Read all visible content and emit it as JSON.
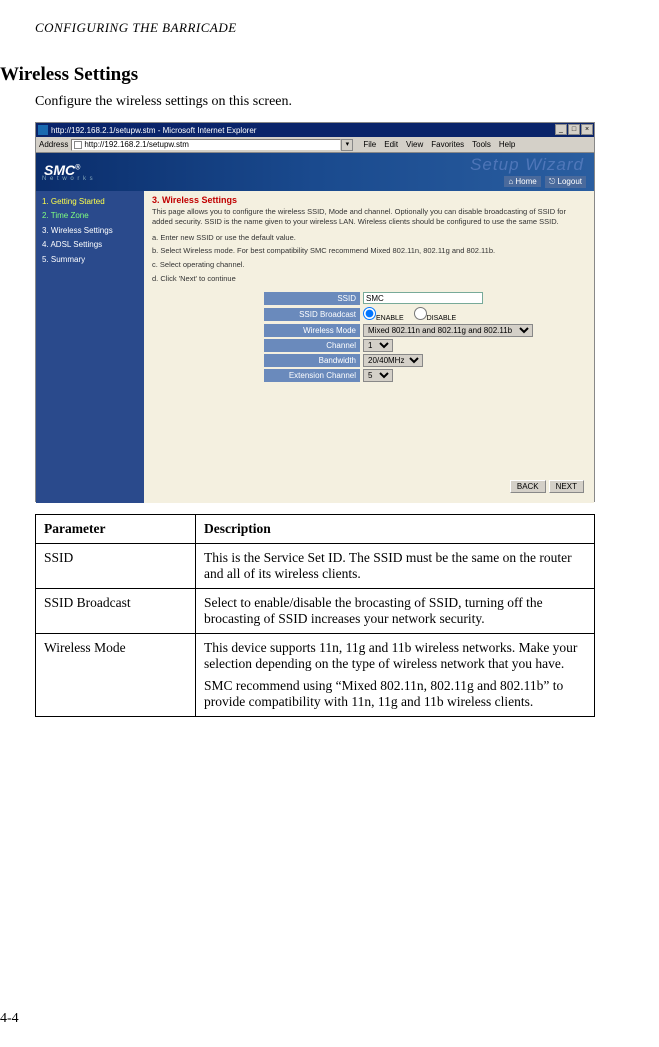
{
  "header": "CONFIGURING THE BARRICADE",
  "section_title": "Wireless Settings",
  "section_intro": "Configure the wireless settings on this screen.",
  "page_number": "4-4",
  "screenshot": {
    "titlebar": "http://192.168.2.1/setupw.stm - Microsoft Internet Explorer",
    "win_min": "_",
    "win_max": "□",
    "win_close": "×",
    "addr_label": "Address",
    "addr_url": "http://192.168.2.1/setupw.stm",
    "addr_go": "▾",
    "menu": [
      "File",
      "Edit",
      "View",
      "Favorites",
      "Tools",
      "Help"
    ],
    "logo": "SMC",
    "logo_reg": "®",
    "logo_sub": "N e t w o r k s",
    "setup_wizard": "Setup Wizard",
    "home_link": "⌂ Home",
    "logout_link": "⎋ Logout",
    "sidebar": [
      {
        "label": "1. Getting Started",
        "cls": "yellow"
      },
      {
        "label": "2. Time Zone",
        "cls": "green"
      },
      {
        "label": "3. Wireless Settings",
        "cls": ""
      },
      {
        "label": "4. ADSL Settings",
        "cls": ""
      },
      {
        "label": "5. Summary",
        "cls": ""
      }
    ],
    "pane_title": "3. Wireless Settings",
    "pane_desc": "This page allows you to configure the wireless SSID, Mode and channel. Optionally you can disable broadcasting of SSID for added security. SSID is the name given to your wireless LAN. Wireless clients should be configured to use the same SSID.",
    "step_a": "a. Enter new SSID or use the default value.",
    "step_b": "b. Select Wireless mode. For best compatibility SMC recommend Mixed 802.11n, 802.11g and 802.11b.",
    "step_c": "c. Select operating channel.",
    "step_d": "d. Click 'Next' to continue",
    "form": {
      "ssid_label": "SSID",
      "ssid_value": "SMC",
      "ssidb_label": "SSID Broadcast",
      "ssidb_enable": "ENABLE",
      "ssidb_disable": "DISABLE",
      "mode_label": "Wireless Mode",
      "mode_value": "Mixed 802.11n and 802.11g and 802.11b",
      "channel_label": "Channel",
      "channel_value": "1",
      "bw_label": "Bandwidth",
      "bw_value": "20/40MHz",
      "ext_label": "Extension Channel",
      "ext_value": "5"
    },
    "back_btn": "BACK",
    "next_btn": "NEXT"
  },
  "table": {
    "head_param": "Parameter",
    "head_desc": "Description",
    "rows": [
      {
        "param": "SSID",
        "desc": [
          "This is the Service Set ID. The SSID must be the same on the router and all of its wireless clients."
        ]
      },
      {
        "param": "SSID Broadcast",
        "desc": [
          "Select to enable/disable the brocasting of SSID, turning off the brocasting of SSID increases your network security."
        ]
      },
      {
        "param": "Wireless Mode",
        "desc": [
          "This device supports 11n, 11g and 11b wireless networks. Make your selection depending on the type of wireless network that you have.",
          "SMC recommend using “Mixed 802.11n, 802.11g and 802.11b” to provide compatibility with 11n, 11g and 11b wireless clients."
        ]
      }
    ]
  }
}
